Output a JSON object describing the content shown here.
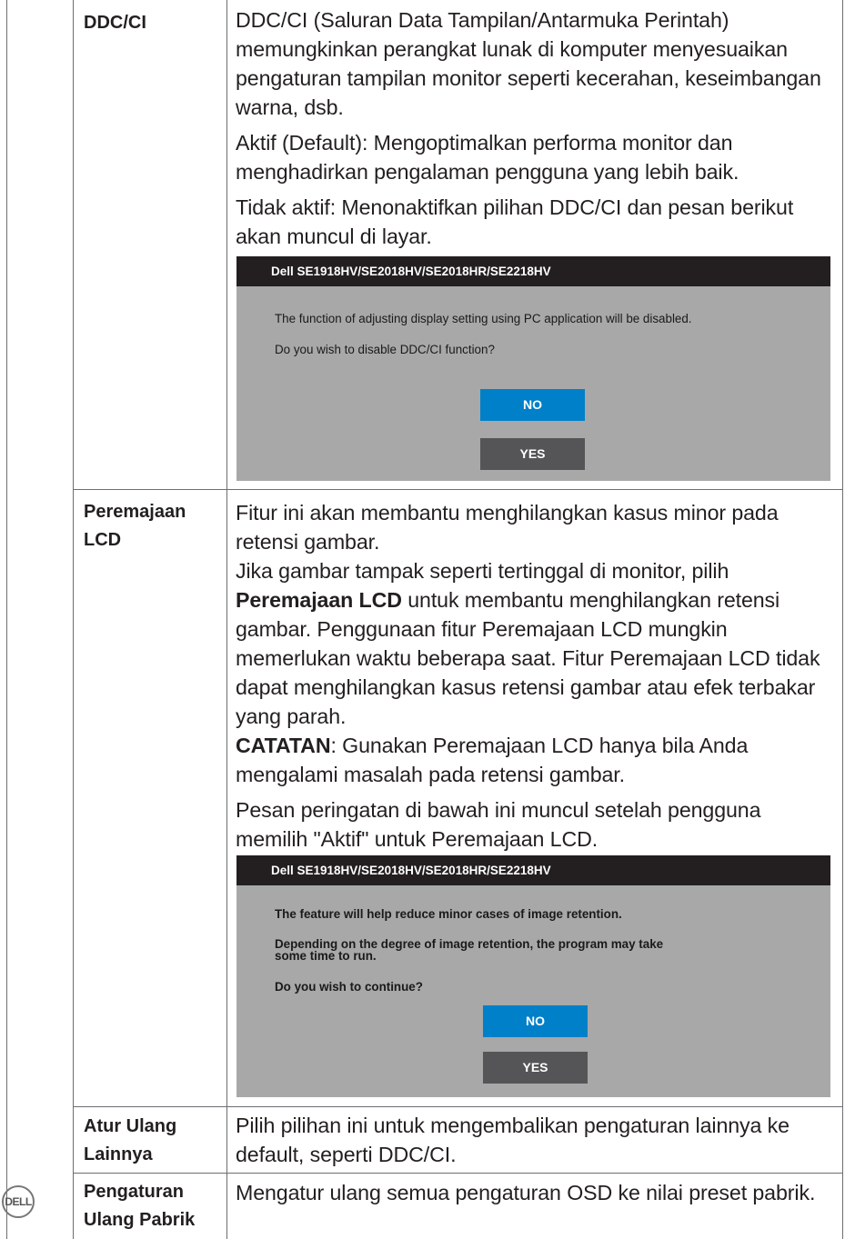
{
  "rows": [
    {
      "label": "DDC/CI",
      "p1": "DDC/CI (Saluran Data Tampilan/Antarmuka Perintah) memungkinkan perangkat lunak di komputer menyesuaikan pengaturan tampilan monitor seperti kecerahan, keseimbangan warna, dsb.",
      "p2": "Aktif (Default): Mengoptimalkan performa monitor dan menghadirkan pengalaman pengguna yang lebih baik.",
      "p3": "Tidak aktif: Menonaktifkan pilihan DDC/CI dan pesan berikut akan muncul di layar.",
      "dialog": {
        "title": "Dell SE1918HV/SE2018HV/SE2018HR/SE2218HV",
        "line1": "The function of adjusting display setting using PC application will be disabled.",
        "line2": "Do you wish to disable DDC/CI function?",
        "no": "NO",
        "yes": "YES"
      }
    },
    {
      "label_line1": "Peremajaan",
      "label_line2": "LCD",
      "p1": "Fitur ini akan membantu menghilangkan kasus minor pada retensi gambar.",
      "p2_pre": "Jika gambar tampak seperti tertinggal di monitor, pilih ",
      "p2_bold": "Peremajaan LCD",
      "p2_post": " untuk membantu menghilangkan retensi gambar. Penggunaan fitur Peremajaan LCD mungkin memerlukan waktu beberapa saat. Fitur Peremajaan LCD tidak dapat menghilangkan kasus retensi gambar atau efek terbakar yang parah.",
      "note_bold": "CATATAN",
      "note_text": ": Gunakan Peremajaan LCD hanya bila Anda mengalami masalah pada retensi gambar.",
      "p3": "Pesan peringatan di bawah ini muncul setelah pengguna memilih \"Aktif\" untuk Peremajaan LCD.",
      "dialog": {
        "title": "Dell SE1918HV/SE2018HV/SE2018HR/SE2218HV",
        "line1": "The feature will help reduce minor cases of image retention.",
        "line2a": "Depending on the degree of image retention, the program may take",
        "line2b": "some time to run.",
        "line3": "Do you wish to continue?",
        "no": "NO",
        "yes": "YES"
      }
    },
    {
      "label_line1": "Atur Ulang",
      "label_line2": "Lainnya",
      "p1": "Pilih pilihan ini untuk mengembalikan pengaturan lainnya ke default, seperti DDC/CI."
    },
    {
      "label_line1": "Pengaturan",
      "label_line2": "Ulang Pabrik",
      "p1": "Mengatur ulang semua pengaturan OSD ke nilai preset pabrik."
    }
  ],
  "logo": "DELL",
  "colors": {
    "no_button": "#0080c8",
    "yes_button": "#555557",
    "dialog_bg": "#a8a8a8",
    "dialog_title_bg": "#231f20"
  }
}
